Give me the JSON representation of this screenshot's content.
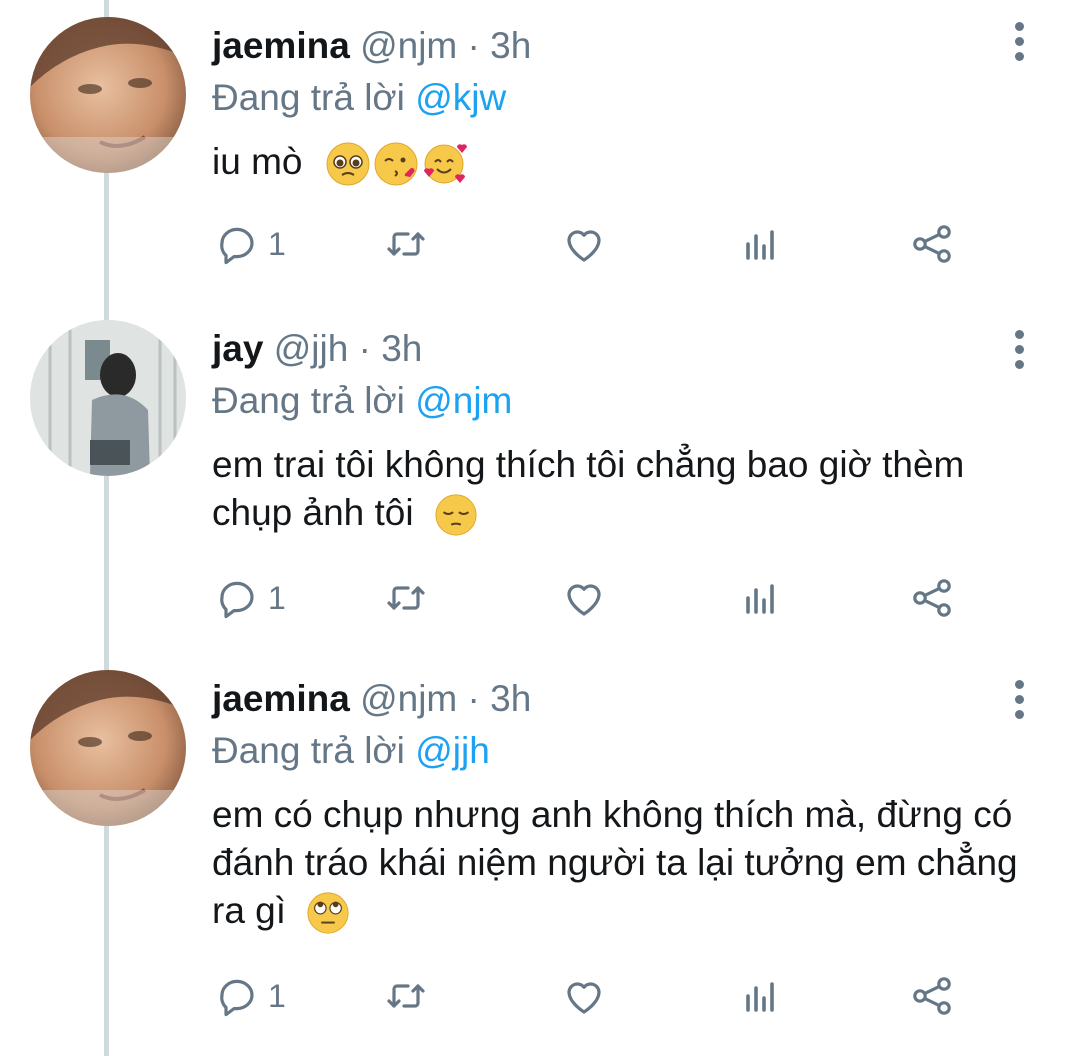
{
  "tweets": [
    {
      "name": "jaemina",
      "handle": "@njm",
      "separator": "·",
      "time": "3h",
      "reply_prefix": "Đang trả lời",
      "reply_to": "@kjw",
      "text": "iu mò",
      "emojis": [
        "pleading-face-emoji",
        "kissing-heart-emoji",
        "smiling-hearts-emoji"
      ],
      "reply_count": "1"
    },
    {
      "name": "jay",
      "handle": "@jjh",
      "separator": "·",
      "time": "3h",
      "reply_prefix": "Đang trả lời",
      "reply_to": "@njm",
      "text": "em trai tôi không thích tôi chẳng bao giờ thèm chụp ảnh tôi",
      "emojis": [
        "pensive-face-emoji"
      ],
      "reply_count": "1"
    },
    {
      "name": "jaemina",
      "handle": "@njm",
      "separator": "·",
      "time": "3h",
      "reply_prefix": "Đang trả lời",
      "reply_to": "@jjh",
      "text": "em có chụp nhưng anh không thích mà, đừng có đánh tráo khái niệm người ta lại tưởng em chẳng ra gì",
      "emojis": [
        "eye-roll-emoji"
      ],
      "reply_count": "1"
    }
  ],
  "colors": {
    "text": "#14171a",
    "muted": "#657786",
    "mention": "#1da1f2",
    "thread_line": "#cfd9de"
  },
  "icons": [
    "reply-icon",
    "retweet-icon",
    "like-icon",
    "stats-icon",
    "share-icon",
    "more-icon"
  ]
}
